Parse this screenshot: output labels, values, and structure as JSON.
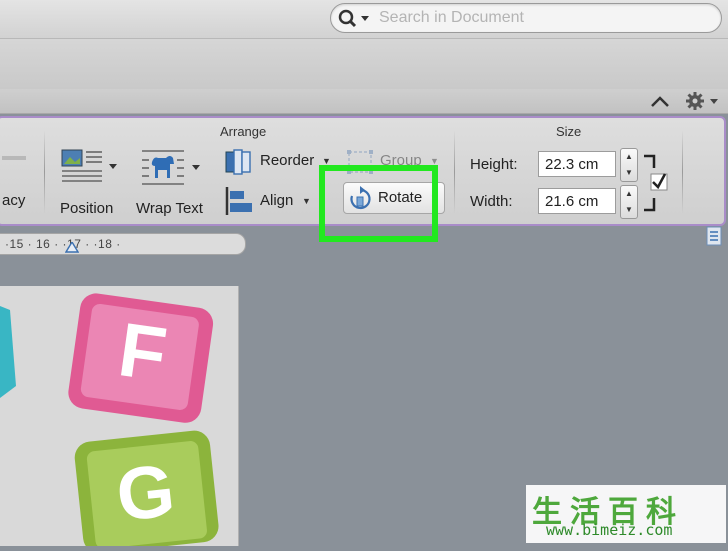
{
  "search": {
    "placeholder": "Search in Document"
  },
  "ribbon": {
    "arrange": {
      "title": "Arrange",
      "partial_label": "acy",
      "position_label": "Position",
      "wrap_text_label": "Wrap Text",
      "reorder_label": "Reorder",
      "align_label": "Align",
      "group_label": "Group",
      "rotate_label": "Rotate"
    },
    "size": {
      "title": "Size",
      "height_label": "Height:",
      "height_value": "22.3 cm",
      "width_label": "Width:",
      "width_value": "21.6 cm",
      "lock_aspect_checked": true
    }
  },
  "ruler": {
    "text": "·15 · 16 · ·17 · ·18 ·"
  },
  "document": {
    "tiles": [
      "F",
      "G"
    ]
  },
  "watermark": {
    "cjk": "生活百科",
    "url": "www.bimeiz.com"
  },
  "colors": {
    "highlight": "#22e81f",
    "ribbon_border": "#a98cc9",
    "tile_pink": "#e05a93",
    "tile_green": "#8cb43c"
  },
  "icons": [
    "search-icon",
    "chevron-up-icon",
    "gear-icon",
    "position-icon",
    "wrap-text-icon",
    "reorder-icon",
    "align-icon",
    "group-icon",
    "rotate-icon",
    "lock-aspect-icon"
  ]
}
